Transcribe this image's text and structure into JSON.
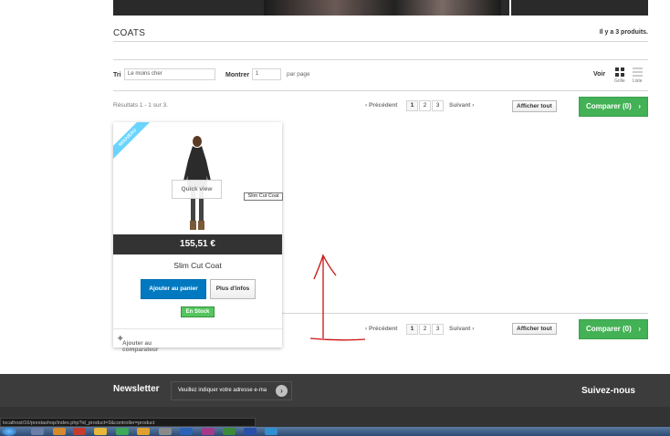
{
  "category": {
    "title": "COATS",
    "product_count": "Il y a 3 produits."
  },
  "sort": {
    "label": "Tri",
    "value": "Le moins cher"
  },
  "perpage": {
    "label": "Montrer",
    "value": "1",
    "suffix": "par page"
  },
  "view": {
    "label": "Voir",
    "grid": "Grille",
    "list": "Liste"
  },
  "results": "Résultats 1 - 1 sur 3.",
  "pagination": {
    "prev": "Précédent",
    "pages": [
      "1",
      "2",
      "3"
    ],
    "next": "Suivant",
    "current": "1"
  },
  "show_all": "Afficher tout",
  "compare": "Comparer (0)",
  "product": {
    "ribbon": "NOUVEAU",
    "quick_view": "Quick view",
    "price": "155,51 €",
    "name": "Slim Cut Coat",
    "add_to_cart": "Ajouter au panier",
    "more_info": "Plus d'infos",
    "stock": "En Stock",
    "add_compare": "Ajouter au comparateur"
  },
  "tooltip": "Slim Cut Coat",
  "footer": {
    "newsletter": "Newsletter",
    "newsletter_placeholder": "Veuillez indiquer votre adresse e-ma",
    "social": "Suivez-nous"
  },
  "status_url": "localhost/16/prestashop/index.php?id_product=3&controller=product",
  "colors": {
    "compare_green": "#43b155",
    "cart_blue": "#0079c1",
    "stock_green": "#55c65e",
    "annotation": "#cc1111",
    "footer": "#333333"
  }
}
